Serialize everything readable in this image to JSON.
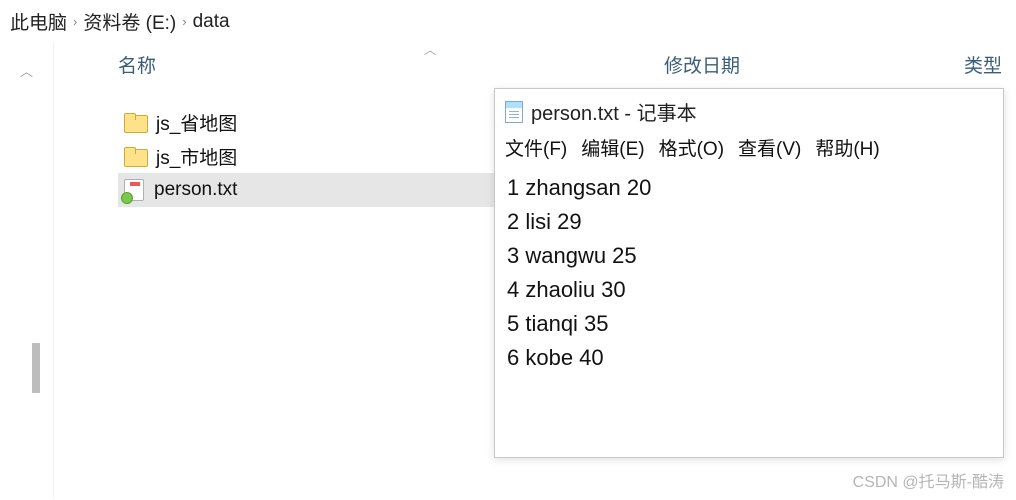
{
  "breadcrumb": {
    "items": [
      "此电脑",
      "资料卷 (E:)",
      "data"
    ],
    "separator": "›"
  },
  "columns": {
    "name": "名称",
    "date": "修改日期",
    "type": "类型"
  },
  "files": [
    {
      "icon": "folder",
      "label": "js_省地图",
      "selected": false
    },
    {
      "icon": "folder",
      "label": "js_市地图",
      "selected": false
    },
    {
      "icon": "txt",
      "label": "person.txt",
      "selected": true
    }
  ],
  "notepad": {
    "title": "person.txt - 记事本",
    "menu": [
      "文件(F)",
      "编辑(E)",
      "格式(O)",
      "查看(V)",
      "帮助(H)"
    ],
    "lines": [
      "1 zhangsan 20",
      "2 lisi 29",
      "3 wangwu 25",
      "4 zhaoliu 30",
      "5 tianqi 35",
      "6 kobe 40"
    ]
  },
  "watermark": "CSDN @托马斯-酷涛"
}
